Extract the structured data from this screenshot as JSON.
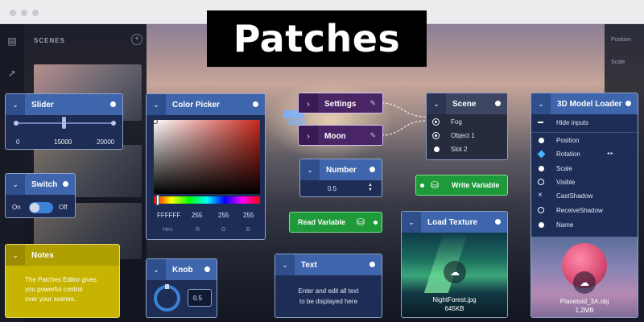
{
  "banner": {
    "title": "Patches"
  },
  "scenes_panel": {
    "title": "SCENES"
  },
  "right_panel": {
    "items": [
      "Position",
      "Scale"
    ]
  },
  "slider": {
    "title": "Slider",
    "min": "0",
    "value": "15000",
    "max": "20000",
    "fill_fraction": 0.75
  },
  "switch": {
    "title": "Switch",
    "on_label": "On",
    "off_label": "Off",
    "state": "on"
  },
  "notes": {
    "title": "Notes",
    "text_line1": "The Patches Editor gives",
    "text_line2": "you powerful control",
    "text_line3": "over your scenes."
  },
  "knob": {
    "title": "Knob",
    "value": "0.5"
  },
  "color_picker": {
    "title": "Color Picker",
    "hex": "FFFFFF",
    "r": "255",
    "g": "255",
    "b": "255",
    "hex_label": "Hex",
    "r_label": "R",
    "g_label": "G",
    "b_label": "B"
  },
  "settings": {
    "title": "Settings"
  },
  "moon": {
    "title": "Moon"
  },
  "number": {
    "title": "Number",
    "value": "0.5"
  },
  "read_variable": {
    "title": "Read Variable"
  },
  "write_variable": {
    "title": "Write Variable"
  },
  "text_node": {
    "title": "Text",
    "line1": "Enter and edit all text",
    "line2": "to be displayed here"
  },
  "scene": {
    "title": "Scene",
    "items": [
      "Fog",
      "Object 1",
      "Slot 2"
    ]
  },
  "load_texture": {
    "title": "Load Texture",
    "file_name": "NightForest.jpg",
    "file_size": "645KB"
  },
  "model_loader": {
    "title": "3D Model Loader",
    "hide_inputs": "Hide inputs",
    "items": [
      "Position",
      "Rotation",
      "Scale",
      "Visible",
      "CastShadow",
      "ReceiveShadow",
      "Name"
    ],
    "file_name": "Planetoid_3A.obj",
    "file_size": "1.2MB"
  },
  "colors": {
    "node_header": "#3f66ac",
    "node_body": "#1e2d55",
    "notes_yellow": "#c7b400",
    "purple": "#4a2566",
    "green": "#1e9a3a",
    "switch_blue": "#3b82d6"
  }
}
